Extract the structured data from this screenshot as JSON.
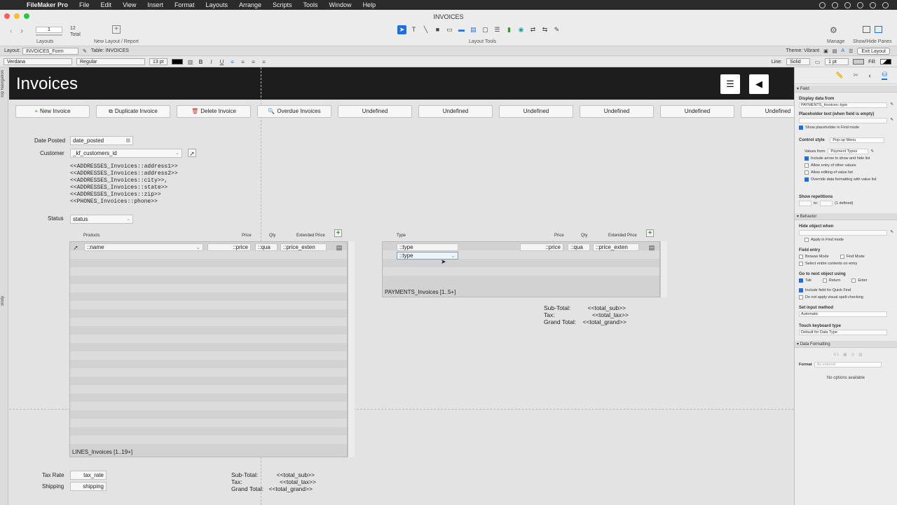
{
  "menubar": {
    "app": "FileMaker Pro",
    "items": [
      "File",
      "Edit",
      "View",
      "Insert",
      "Format",
      "Layouts",
      "Arrange",
      "Scripts",
      "Tools",
      "Window",
      "Help"
    ]
  },
  "window": {
    "title": "INVOICES",
    "record_value": "1",
    "record_total": "12",
    "total_label": "Total",
    "layouts_label": "Layouts",
    "new_layout_label": "New Layout / Report",
    "layout_tools_label": "Layout Tools",
    "manage_label": "Manage",
    "show_hide_label": "Show/Hide Panes"
  },
  "layoutbar": {
    "layout_label": "Layout:",
    "layout_name": "INVOICES_Form",
    "table_label": "Table: INVOICES",
    "theme_label": "Theme: Vibrant",
    "exit_label": "Exit Layout"
  },
  "formatbar": {
    "font": "Verdana",
    "style": "Regular",
    "size": "13 pt",
    "line_label": "Line:",
    "line_style": "Solid",
    "line_width": "1 pt",
    "fill_label": "Fill:"
  },
  "canvas": {
    "title": "Invoices",
    "ruler_top": "Top Navigation",
    "ruler_body": "Body",
    "buttons": [
      {
        "icon": "+",
        "label": "New Invoice"
      },
      {
        "icon": "⧉",
        "label": "Duplicate Invoice"
      },
      {
        "icon": "🗑",
        "label": "Delete Invoice"
      },
      {
        "icon": "🔍",
        "label": "Overdue Invoices"
      },
      {
        "icon": "",
        "label": "Undefined"
      },
      {
        "icon": "",
        "label": "Undefined"
      },
      {
        "icon": "",
        "label": "Undefined"
      },
      {
        "icon": "",
        "label": "Undefined"
      },
      {
        "icon": "",
        "label": "Undefined"
      },
      {
        "icon": "",
        "label": "Undefined"
      }
    ],
    "date_posted_label": "Date Posted",
    "date_posted_field": "date_posted",
    "customer_label": "Customer",
    "customer_field": "_kf_customers_id",
    "address_lines": [
      "<<ADDRESSES_Invoices::address1>>",
      "<<ADDRESSES_Invoices::address2>>",
      "<<ADDRESSES_Invoices::city>>,",
      "<<ADDRESSES_Invoices::state>>",
      "<<ADDRESSES_Invoices::zip>>",
      "<<PHONES_Invoices::phone>>"
    ],
    "status_label": "Status",
    "status_field": "status",
    "lines_portal": {
      "headers": {
        "products": "Products",
        "price": "Price",
        "qty": "Qty",
        "extended": "Extended Price"
      },
      "name_field": "::name",
      "price_field": "::price",
      "qty_field": "::qua",
      "ext_field": "::price_exten",
      "label": "LINES_Invoices [1..19+]"
    },
    "payments_portal": {
      "headers": {
        "type": "Type",
        "price": "Price",
        "qty": "Qty",
        "extended": "Extended Price"
      },
      "type_field": "::type",
      "type_field_2": "::type",
      "price_field": "::price",
      "qty_field": "::qua",
      "ext_field": "::price_exten",
      "label": "PAYMENTS_Invoices [1..5+]"
    },
    "totals_right": {
      "sub_label": "Sub-Total:",
      "sub_val": "<<total_sub>>",
      "tax_label": "Tax:",
      "tax_val": "<<total_tax>>",
      "grand_label": "Grand Total:",
      "grand_val": "<<total_grand>>"
    },
    "tax_rate_label": "Tax Rate",
    "tax_rate_field": "tax_rate",
    "shipping_label": "Shipping",
    "shipping_field": "shipping",
    "totals_bottom": {
      "sub_label": "Sub-Total:",
      "sub_val": "<<total_sub>>",
      "tax_label": "Tax:",
      "tax_val": "<<total_tax>>",
      "grand_label": "Grand Total:",
      "grand_val": "<<total_grand>>"
    }
  },
  "inspector": {
    "field_section": "Field",
    "display_data_label": "Display data from",
    "display_data_value": "PAYMENTS_Invoices::type",
    "placeholder_label": "Placeholder text (when field is empty)",
    "show_placeholder": "Show placeholder in Find mode",
    "control_style_label": "Control style",
    "control_style_value": "Pop-up Menu",
    "values_from_label": "Values from:",
    "values_from_value": "Payment Types",
    "include_arrow": "Include arrow to show and hide list",
    "allow_entry": "Allow entry of other values",
    "allow_editing": "Allow editing of value list",
    "override_format": "Override data formatting with value list",
    "show_repetitions": "Show repetitions",
    "rep_to": "to:",
    "rep_defined": "(1 defined)",
    "behavior_section": "Behavior",
    "hide_object": "Hide object when",
    "apply_find": "Apply in Find mode",
    "field_entry": "Field entry",
    "browse_mode": "Browse Mode",
    "find_mode": "Find Mode",
    "select_entire": "Select entire contents on entry",
    "go_next": "Go to next object using",
    "tab": "Tab",
    "return": "Return",
    "enter": "Enter",
    "quick_find": "Include field for Quick Find",
    "spell_check": "Do not apply visual spell-checking",
    "input_method": "Set input method",
    "input_method_value": "Automatic",
    "touch_kb": "Touch keyboard type",
    "touch_kb_value": "Default for Data Type",
    "data_formatting_section": "Data Formatting",
    "format_label": "Format",
    "format_value": "As entered",
    "no_options": "No options available"
  }
}
